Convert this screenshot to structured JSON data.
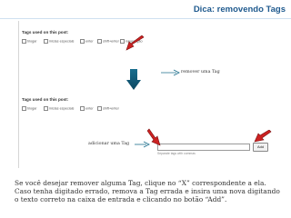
{
  "header": {
    "title": "Dica: removendo Tags"
  },
  "panel_top": {
    "title": "Tags used on this post:",
    "tags": [
      "blogar",
      "inicias especiais",
      "enter",
      "shift+enter",
      "navegação"
    ]
  },
  "panel_bottom": {
    "title": "Tags used on this post:",
    "tags": [
      "blogar",
      "inicias especiais",
      "enter",
      "shift+enter"
    ]
  },
  "labels": {
    "remove": "remover uma Tag",
    "add": "adicionar uma Tag"
  },
  "add_form": {
    "button_label": "Add",
    "hint": "Separate tags with commas"
  },
  "body_text": {
    "line1": "Se você desejar remover alguma Tag, clique no “X” correspondente a ela.",
    "line2": "Caso tenha digitado errado, remova a Tag errada e insira uma nova digitando o texto correto na caixa de entrada e clicando no botão “Add”."
  },
  "colors": {
    "title": "#1f5a8e",
    "arrow_red": "#cc2222",
    "arrow_teal": "#1e6f8c"
  }
}
